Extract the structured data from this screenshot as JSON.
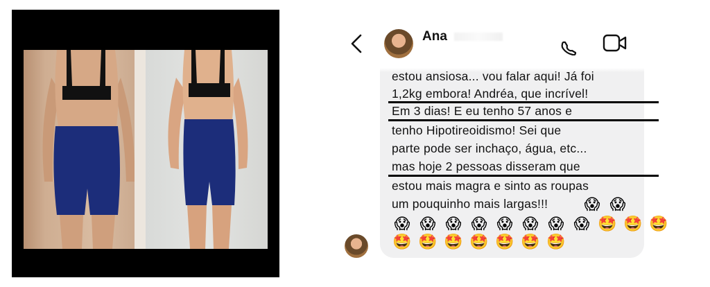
{
  "header": {
    "contact_name": "Ana"
  },
  "message": {
    "lines": [
      "estou ansiosa... vou falar aqui! Já foi",
      "1,2kg embora! Andréa, que incrível!",
      "Em 3 dias! E eu tenho 57 anos e",
      "tenho Hipotireoidismo! Sei que",
      "parte pode ser inchaço, água, etc...",
      "mas hoje 2 pessoas disseram que",
      "estou mais magra e sinto as roupas",
      "um pouquinho mais largas!!!"
    ],
    "emoji_line_end": [
      "😱",
      "😱"
    ],
    "emoji_row_2": [
      "😱",
      "😱",
      "😱",
      "😱",
      "😱",
      "😱",
      "😱",
      "😱",
      "🤩",
      "🤩",
      "🤩"
    ],
    "emoji_row_3": [
      "🤩",
      "🤩",
      "🤩",
      "🤩",
      "🤩",
      "🤩",
      "🤩"
    ]
  },
  "icons": {
    "back": "chevron-left-icon",
    "call": "phone-icon",
    "video": "video-camera-icon"
  },
  "colors": {
    "bubble": "#f0f0f1",
    "text": "#111111",
    "frame": "#000000",
    "shorts": "#1c2d7a"
  }
}
